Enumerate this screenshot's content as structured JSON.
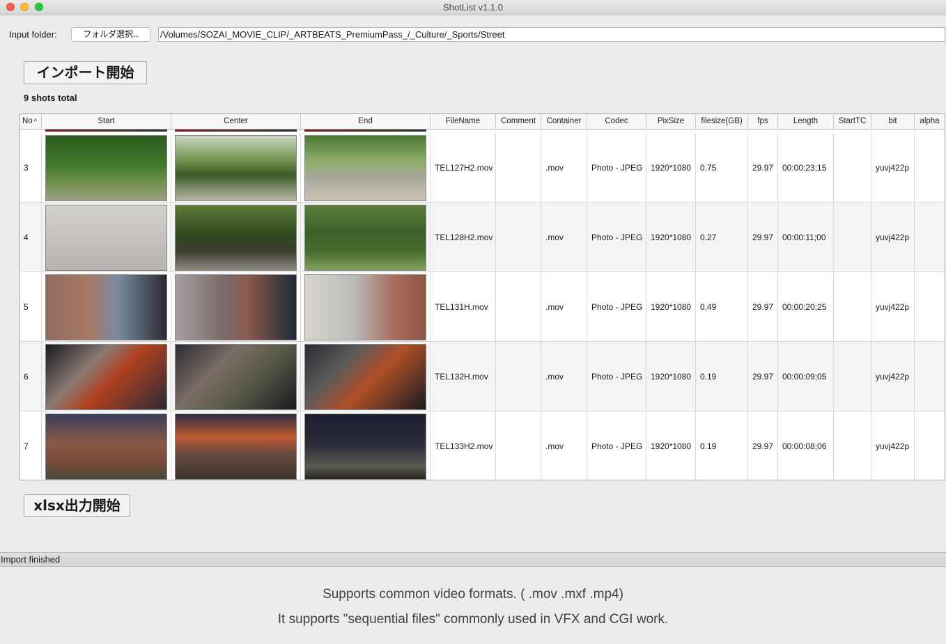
{
  "window": {
    "title": "ShotList v1.1.0"
  },
  "input": {
    "label": "Input folder:",
    "folder_button": "フォルダ選択..",
    "path": "/Volumes/SOZAI_MOVIE_CLIP/_ARTBEATS_PremiumPass_/_Culture/_Sports/Street"
  },
  "import_button": "インポート開始",
  "shots_total": "9 shots total",
  "table": {
    "columns": [
      "No",
      "Start",
      "Center",
      "End",
      "FileName",
      "Comment",
      "Container",
      "Codec",
      "PixSize",
      "filesize(GB)",
      "fps",
      "Length",
      "StartTC",
      "bit",
      "alpha"
    ],
    "sort_indicator": "^",
    "rows": [
      {
        "no": "3",
        "filename": "TEL127H2.mov",
        "comment": "",
        "container": ".mov",
        "codec": "Photo - JPEG",
        "pixsize": "1920*1080",
        "filesize": "0.75",
        "fps": "29.97",
        "length": "00:00:23;15",
        "starttc": "",
        "bit": "yuvj422p",
        "alpha": ""
      },
      {
        "no": "4",
        "filename": "TEL128H2.mov",
        "comment": "",
        "container": ".mov",
        "codec": "Photo - JPEG",
        "pixsize": "1920*1080",
        "filesize": "0.27",
        "fps": "29.97",
        "length": "00:00:11;00",
        "starttc": "",
        "bit": "yuvj422p",
        "alpha": ""
      },
      {
        "no": "5",
        "filename": "TEL131H.mov",
        "comment": "",
        "container": ".mov",
        "codec": "Photo - JPEG",
        "pixsize": "1920*1080",
        "filesize": "0.49",
        "fps": "29.97",
        "length": "00:00:20;25",
        "starttc": "",
        "bit": "yuvj422p",
        "alpha": ""
      },
      {
        "no": "6",
        "filename": "TEL132H.mov",
        "comment": "",
        "container": ".mov",
        "codec": "Photo - JPEG",
        "pixsize": "1920*1080",
        "filesize": "0.19",
        "fps": "29.97",
        "length": "00:00:09;05",
        "starttc": "",
        "bit": "yuvj422p",
        "alpha": ""
      },
      {
        "no": "7",
        "filename": "TEL133H2.mov",
        "comment": "",
        "container": ".mov",
        "codec": "Photo - JPEG",
        "pixsize": "1920*1080",
        "filesize": "0.19",
        "fps": "29.97",
        "length": "00:00:08;06",
        "starttc": "",
        "bit": "yuvj422p",
        "alpha": ""
      }
    ]
  },
  "xlsx_button": "xlsx出力開始",
  "status": "Import finished",
  "footer": {
    "line1": "Supports common video formats. ( .mov .mxf .mp4)",
    "line2": "It supports \"sequential files\" commonly used in VFX and CGI work."
  }
}
